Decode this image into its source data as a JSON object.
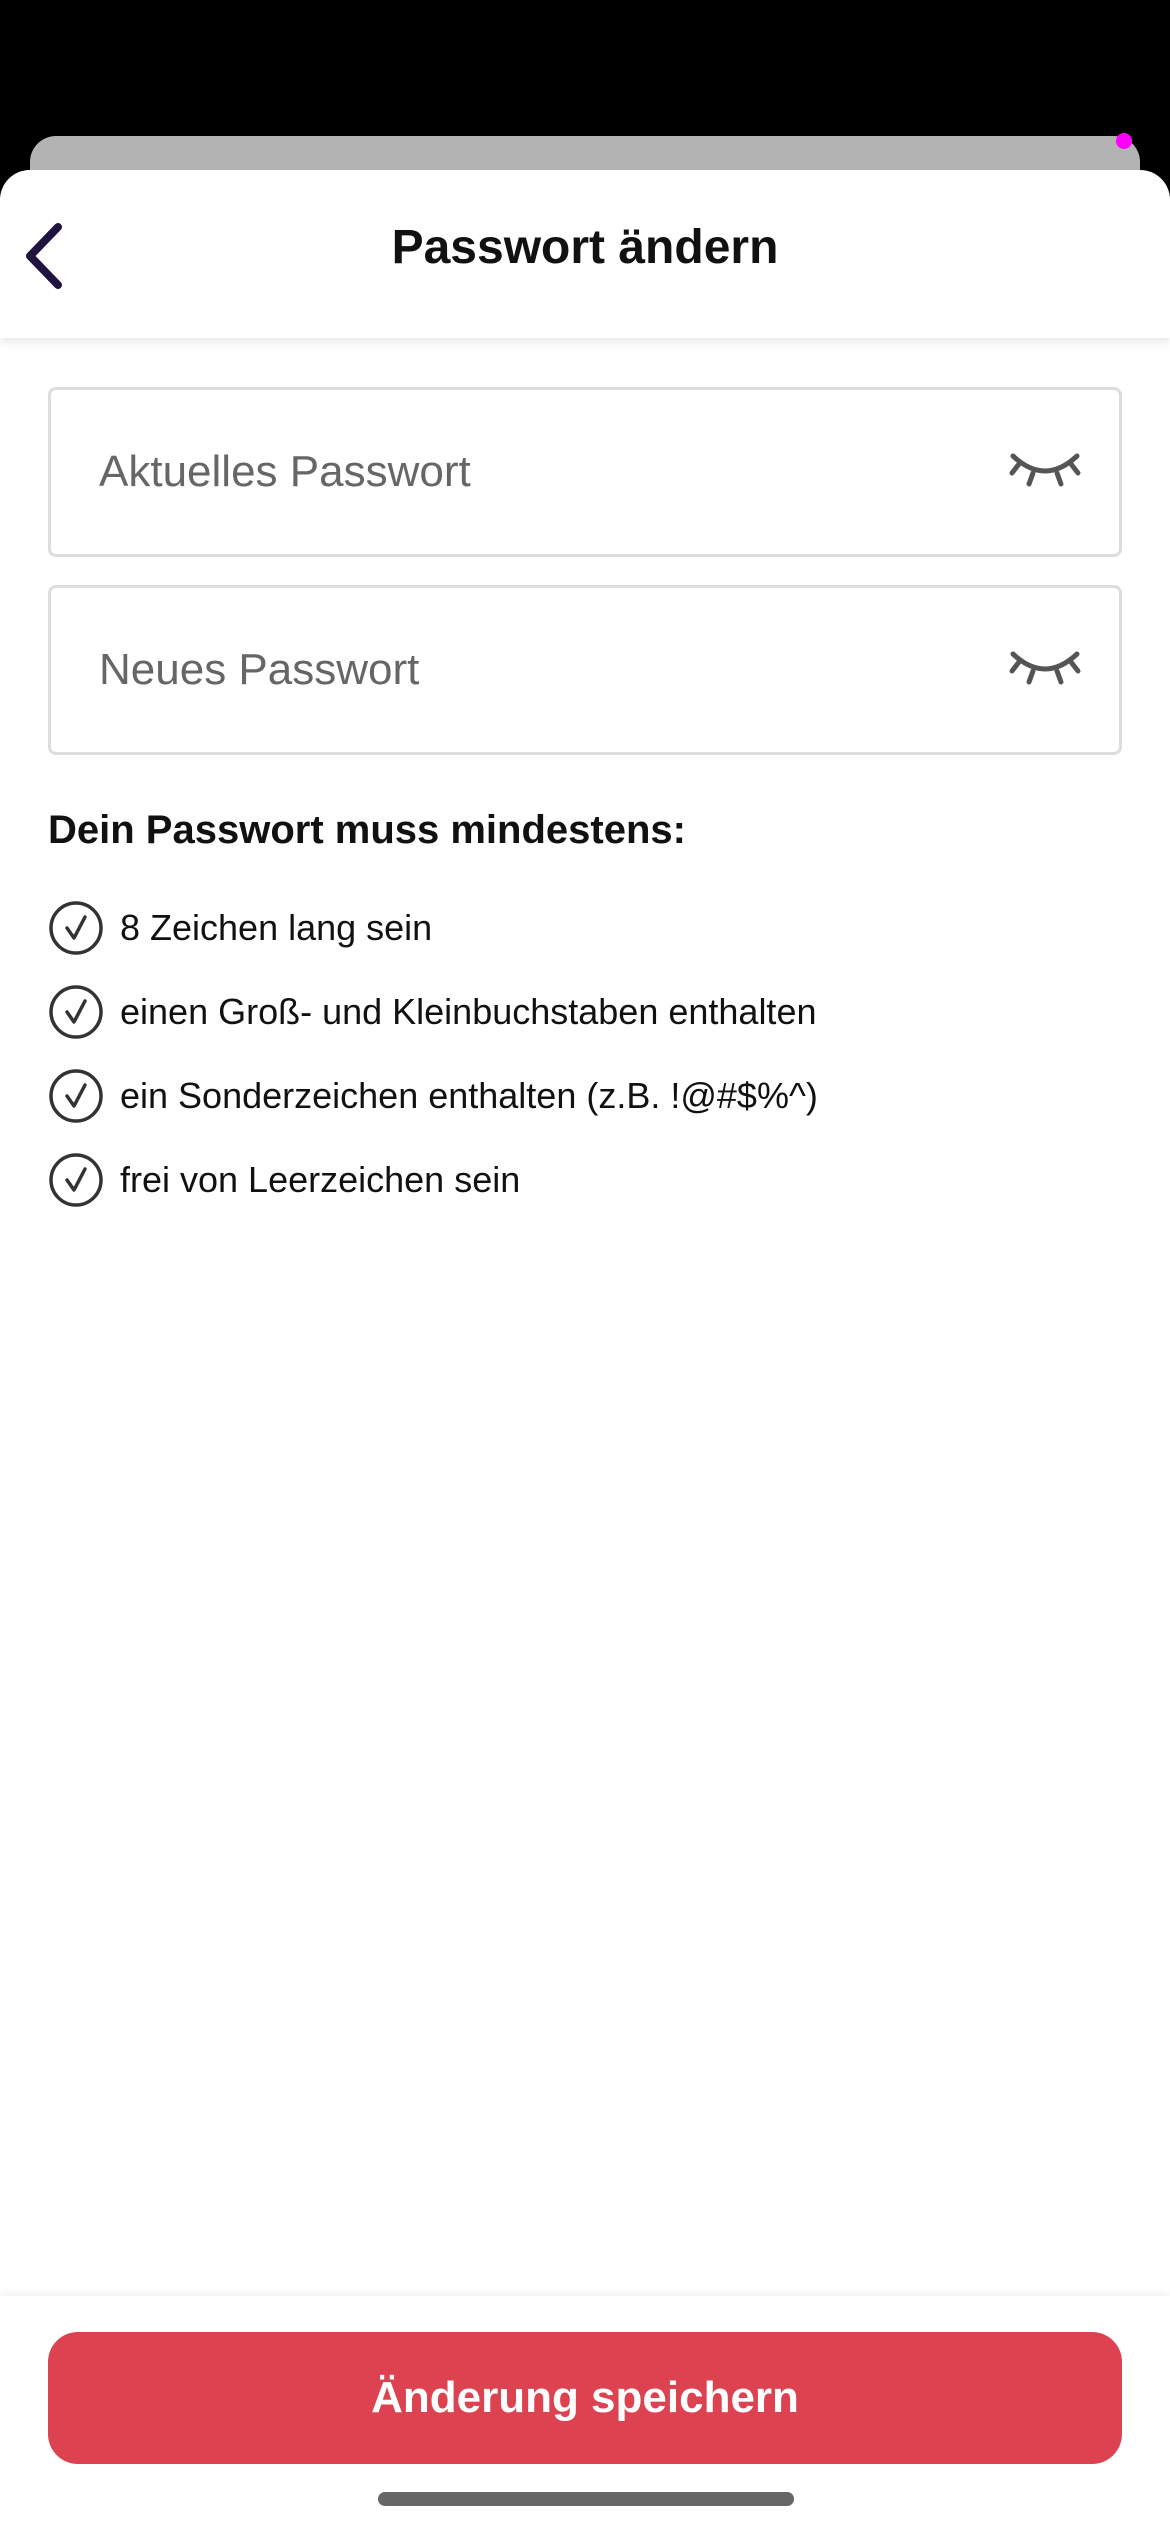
{
  "header": {
    "title": "Passwort ändern",
    "back_icon": "chevron-left-icon"
  },
  "form": {
    "current_password": {
      "placeholder": "Aktuelles Passwort",
      "value": "",
      "toggle_icon": "eye-closed-icon"
    },
    "new_password": {
      "placeholder": "Neues Passwort",
      "value": "",
      "toggle_icon": "eye-closed-icon"
    }
  },
  "rules": {
    "heading": "Dein Passwort muss mindestens:",
    "icon": "check-circle-icon",
    "items": [
      "8 Zeichen lang sein",
      "einen Groß- und Kleinbuchstaben enthalten",
      "ein Sonderzeichen enthalten (z.B. !@#$%^)",
      "frei von Leerzeichen sein"
    ]
  },
  "footer": {
    "save_label": "Änderung speichern"
  },
  "colors": {
    "accent": "#dc424f",
    "back_chevron": "#1f1440",
    "background_overlay": "#000000",
    "sheet_behind": "#b3b3b3",
    "indicator_dot": "#ff00ff"
  }
}
